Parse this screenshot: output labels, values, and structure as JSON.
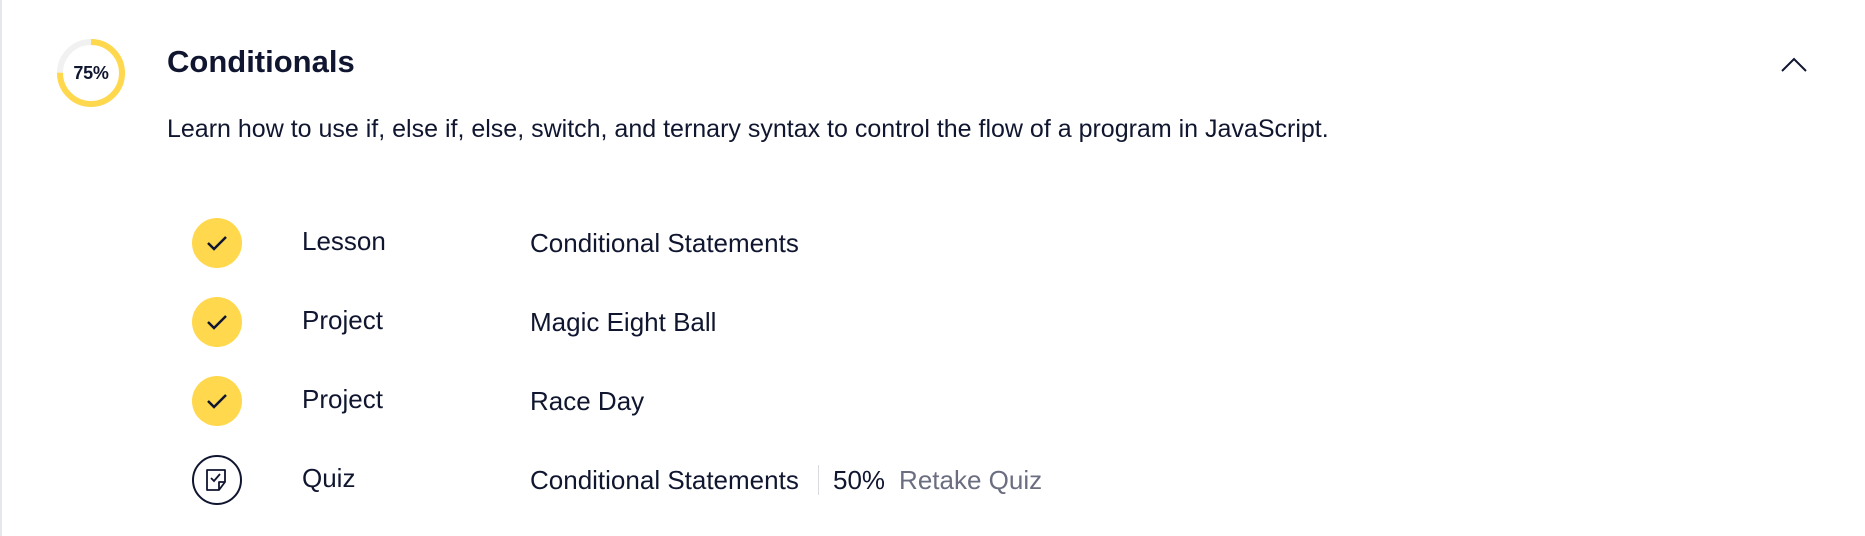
{
  "colors": {
    "accent": "#ffd84d",
    "text": "#10162f",
    "muted": "#6b6e80",
    "track": "#f1f1f1"
  },
  "module": {
    "progress_label": "75%",
    "progress_fraction": 0.75,
    "title": "Conditionals",
    "description": "Learn how to use if, else if, else, switch, and ternary syntax to control the flow of a program in JavaScript.",
    "collapse_icon": "chevron-up-icon"
  },
  "items": [
    {
      "status": "completed",
      "icon": "check-icon",
      "type": "Lesson",
      "name": "Conditional Statements"
    },
    {
      "status": "completed",
      "icon": "check-icon",
      "type": "Project",
      "name": "Magic Eight Ball"
    },
    {
      "status": "completed",
      "icon": "check-icon",
      "type": "Project",
      "name": "Race Day"
    },
    {
      "status": "quiz",
      "icon": "quiz-icon",
      "type": "Quiz",
      "name": "Conditional Statements",
      "score": "50%",
      "action_label": "Retake Quiz"
    }
  ]
}
